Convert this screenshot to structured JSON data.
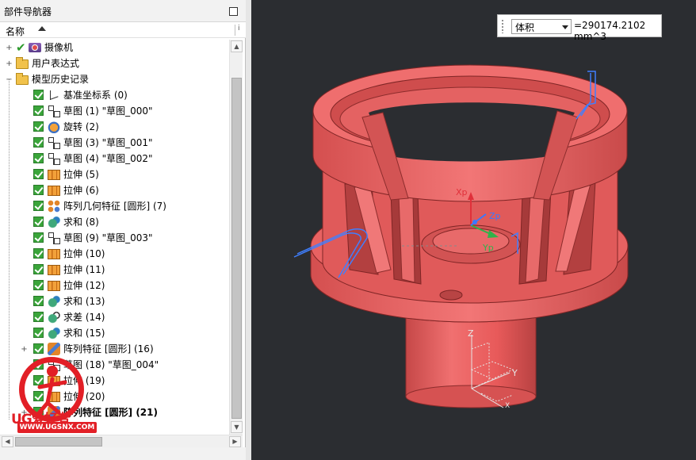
{
  "navigator": {
    "title": "部件导航器",
    "column_name": "名称",
    "column2_label": "i"
  },
  "tree": [
    {
      "label": "摄像机",
      "icon": "camera-icon",
      "kind": "root-tick"
    },
    {
      "label": "用户表达式",
      "icon": "folder-icon",
      "kind": "folder"
    },
    {
      "label": "模型历史记录",
      "icon": "folder-open-icon",
      "kind": "folder-open"
    },
    {
      "label": "基准坐标系 (0)",
      "icon": "datum-csys-icon",
      "kind": "feature"
    },
    {
      "label": "草图 (1) \"草图_000\"",
      "icon": "sketch-icon",
      "kind": "feature"
    },
    {
      "label": "旋转 (2)",
      "icon": "revolve-icon",
      "kind": "feature"
    },
    {
      "label": "草图 (3) \"草图_001\"",
      "icon": "sketch-icon",
      "kind": "feature"
    },
    {
      "label": "草图 (4) \"草图_002\"",
      "icon": "sketch-icon",
      "kind": "feature"
    },
    {
      "label": "拉伸 (5)",
      "icon": "extrude-icon",
      "kind": "feature"
    },
    {
      "label": "拉伸 (6)",
      "icon": "extrude-icon",
      "kind": "feature"
    },
    {
      "label": "阵列几何特征 [圆形] (7)",
      "icon": "pattern-geometry-icon",
      "kind": "feature"
    },
    {
      "label": "求和 (8)",
      "icon": "unite-icon",
      "kind": "feature"
    },
    {
      "label": "草图 (9) \"草图_003\"",
      "icon": "sketch-icon",
      "kind": "feature"
    },
    {
      "label": "拉伸 (10)",
      "icon": "extrude-icon",
      "kind": "feature"
    },
    {
      "label": "拉伸 (11)",
      "icon": "extrude-icon",
      "kind": "feature"
    },
    {
      "label": "拉伸 (12)",
      "icon": "extrude-icon",
      "kind": "feature"
    },
    {
      "label": "求和 (13)",
      "icon": "unite-icon",
      "kind": "feature"
    },
    {
      "label": "求差 (14)",
      "icon": "subtract-icon",
      "kind": "feature"
    },
    {
      "label": "求和 (15)",
      "icon": "unite-icon",
      "kind": "feature"
    },
    {
      "label": "阵列特征 [圆形] (16)",
      "icon": "pattern-feature-icon",
      "kind": "feature-expandable"
    },
    {
      "label": "草图 (18) \"草图_004\"",
      "icon": "sketch-icon",
      "kind": "feature"
    },
    {
      "label": "拉伸 (19)",
      "icon": "extrude-icon",
      "kind": "feature"
    },
    {
      "label": "拉伸 (20)",
      "icon": "extrude-icon",
      "kind": "feature"
    },
    {
      "label": "阵列特征 [圆形] (21)",
      "icon": "pattern-feature-icon",
      "kind": "feature-expandable-bold"
    }
  ],
  "watermark": {
    "brand": "UG爱好者",
    "url": "WWW.UGSNX.COM"
  },
  "measure_bar": {
    "selected_option": "体积",
    "value": "=290174.2102 mm^3"
  },
  "viewport": {
    "background": "#2b2d31",
    "model_color": "#e85a5a",
    "wcs_labels": {
      "x": "Xp",
      "y": "Yp",
      "z": "Zp"
    },
    "triad_labels": {
      "x": "X",
      "y": "Y",
      "z": "Z"
    }
  }
}
